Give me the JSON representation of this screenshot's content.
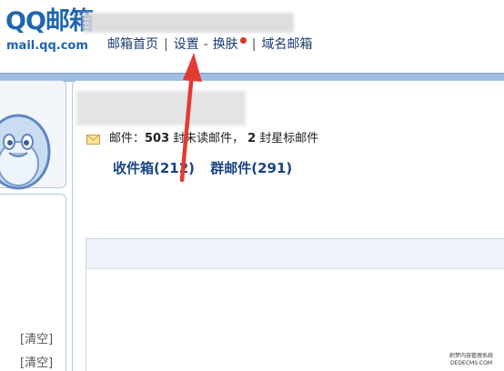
{
  "header": {
    "logo": "QQ邮箱",
    "logo_sub": "mail.qq.com",
    "nav": {
      "home": "邮箱首页",
      "separator": "|",
      "settings": "设置",
      "dash": "-",
      "skin": "换肤",
      "domain_mail": "域名邮箱"
    }
  },
  "mail_summary": {
    "label": "邮件：",
    "unread_count": "503",
    "unread_text": "封未读邮件，",
    "starred_count": "2",
    "starred_text": "封星标邮件"
  },
  "folders": {
    "inbox": "收件箱(212)",
    "group": "群邮件(291)"
  },
  "sidebar": {
    "clear_links": [
      "[清空]",
      "[清空]"
    ]
  },
  "watermark": {
    "line1": "织梦内容管理系统",
    "line2": "DEDECMS.COM"
  },
  "colors": {
    "logo": "#1f66b0",
    "link": "#1a3b73",
    "band": "#9dbde2",
    "arrow": "#e53a33",
    "notify_dot": "#d9321e"
  }
}
